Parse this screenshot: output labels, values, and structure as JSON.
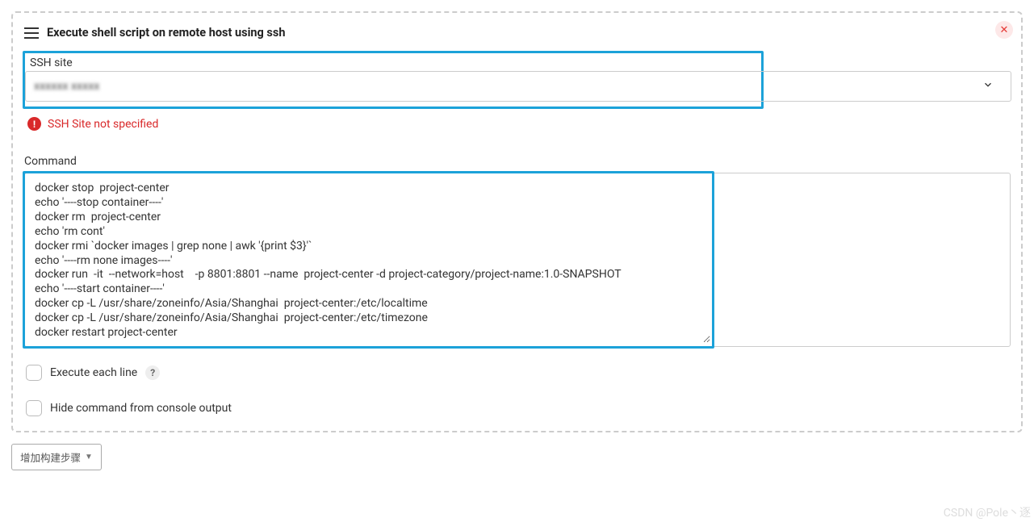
{
  "panel": {
    "title": "Execute shell script on remote host using ssh"
  },
  "ssh": {
    "label": "SSH site",
    "value": "xxxxxx xxxxx",
    "errorText": "SSH Site not specified"
  },
  "command": {
    "label": "Command",
    "value": "docker stop  project-center\necho '----stop container----'\ndocker rm  project-center\necho 'rm cont'\ndocker rmi `docker images | grep none | awk '{print $3}'`\necho '----rm none images----'\ndocker run  -it  --network=host    -p 8801:8801 --name  project-center -d project-category/project-name:1.0-SNAPSHOT\necho '----start container----'\ndocker cp -L /usr/share/zoneinfo/Asia/Shanghai  project-center:/etc/localtime\ndocker cp -L /usr/share/zoneinfo/Asia/Shanghai  project-center:/etc/timezone\ndocker restart project-center"
  },
  "options": {
    "executeEachLine": "Execute each line",
    "hideCommand": "Hide command from console output"
  },
  "footer": {
    "addStep": "增加构建步骤"
  },
  "watermark": "CSDN @Pole丶逐"
}
